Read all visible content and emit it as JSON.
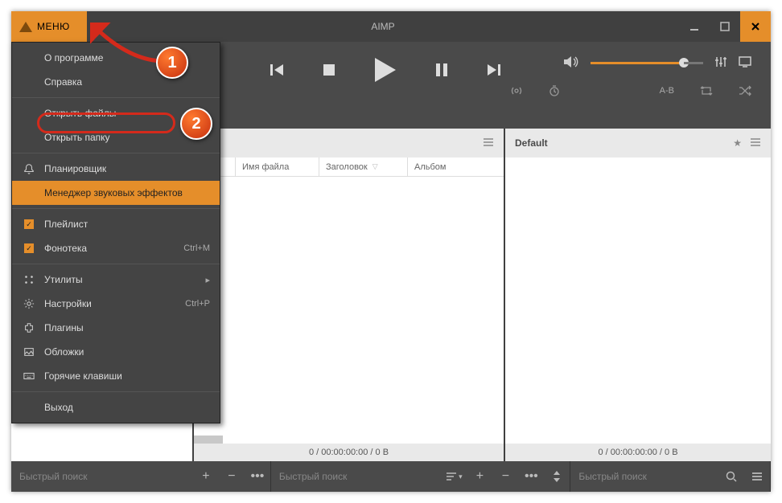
{
  "app": {
    "title": "AIMP",
    "menu_label": "МЕНЮ"
  },
  "menu": {
    "about": "О программе",
    "help": "Справка",
    "open_files": "Открыть файлы",
    "open_folder": "Открыть папку",
    "scheduler": "Планировщик",
    "fx_manager": "Менеджер звуковых эффектов",
    "playlist": "Плейлист",
    "library": "Фонотека",
    "library_sc": "Ctrl+M",
    "utilities": "Утилиты",
    "settings": "Настройки",
    "settings_sc": "Ctrl+P",
    "plugins": "Плагины",
    "covers": "Обложки",
    "hotkeys": "Горячие клавиши",
    "exit": "Выход"
  },
  "columns": {
    "num": "№",
    "filename": "Имя файла",
    "title": "Заголовок",
    "album": "Альбом"
  },
  "tabs": {
    "default": "Default"
  },
  "status": {
    "mid": "0 / 00:00:00:00 / 0 B",
    "right": "0 / 00:00:00:00 / 0 B"
  },
  "search": {
    "placeholder": "Быстрый поиск"
  },
  "extras": {
    "ab": "A-B"
  },
  "badges": {
    "one": "1",
    "two": "2"
  }
}
